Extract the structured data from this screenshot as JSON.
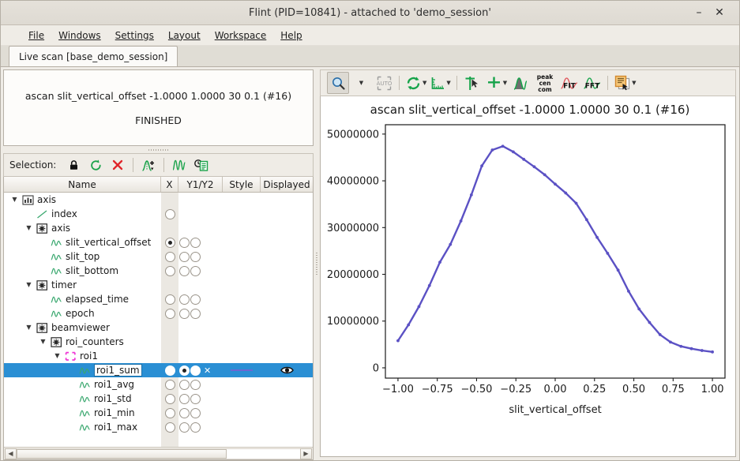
{
  "window": {
    "title": "Flint (PID=10841) - attached to 'demo_session'",
    "minimize_label": "–",
    "close_label": "✕"
  },
  "menubar": {
    "items": [
      {
        "label": "File"
      },
      {
        "label": "Windows"
      },
      {
        "label": "Settings"
      },
      {
        "label": "Layout"
      },
      {
        "label": "Workspace"
      },
      {
        "label": "Help"
      }
    ]
  },
  "tabs": [
    {
      "label": "Live scan [base_demo_session]",
      "active": true
    }
  ],
  "scan_info": {
    "command": "ascan slit_vertical_offset -1.0000 1.0000 30 0.1 (#16)",
    "state": "FINISHED"
  },
  "selection_toolbar": {
    "label": "Selection:",
    "buttons": [
      {
        "name": "lock-icon",
        "title": "lock"
      },
      {
        "name": "reset-icon",
        "title": "reset"
      },
      {
        "name": "remove-icon",
        "title": "remove"
      },
      {
        "name": "add-curve-icon",
        "title": "add curve"
      },
      {
        "name": "peaks-icon",
        "title": "peaks"
      },
      {
        "name": "scan-history-icon",
        "title": "scan history"
      }
    ]
  },
  "tree": {
    "columns": [
      "Name",
      "X",
      "Y1/Y2",
      "Style",
      "Displayed"
    ],
    "rows": [
      {
        "label": "axis",
        "depth": 0,
        "icon": "chart-icon",
        "expander": "down",
        "x": null,
        "y": null,
        "selected": false
      },
      {
        "label": "index",
        "depth": 1,
        "icon": "line-icon",
        "expander": "none",
        "x": "off",
        "y": null,
        "selected": false
      },
      {
        "label": "axis",
        "depth": 1,
        "icon": "device-icon",
        "expander": "down",
        "x": null,
        "y": null,
        "selected": false
      },
      {
        "label": "slit_vertical_offset",
        "depth": 2,
        "icon": "curve-icon",
        "expander": "none",
        "x": "on",
        "y": [
          "off",
          "off"
        ],
        "selected": false
      },
      {
        "label": "slit_top",
        "depth": 2,
        "icon": "curve-icon",
        "expander": "none",
        "x": "off",
        "y": [
          "off",
          "off"
        ],
        "selected": false
      },
      {
        "label": "slit_bottom",
        "depth": 2,
        "icon": "curve-icon",
        "expander": "none",
        "x": "off",
        "y": [
          "off",
          "off"
        ],
        "selected": false
      },
      {
        "label": "timer",
        "depth": 1,
        "icon": "device-icon",
        "expander": "down",
        "x": null,
        "y": null,
        "selected": false
      },
      {
        "label": "elapsed_time",
        "depth": 2,
        "icon": "curve-icon",
        "expander": "none",
        "x": "off",
        "y": [
          "off",
          "off"
        ],
        "selected": false
      },
      {
        "label": "epoch",
        "depth": 2,
        "icon": "curve-icon",
        "expander": "none",
        "x": "off",
        "y": [
          "off",
          "off"
        ],
        "selected": false
      },
      {
        "label": "beamviewer",
        "depth": 1,
        "icon": "device-icon",
        "expander": "down",
        "x": null,
        "y": null,
        "selected": false
      },
      {
        "label": "roi_counters",
        "depth": 2,
        "icon": "device-icon",
        "expander": "down",
        "x": null,
        "y": null,
        "selected": false
      },
      {
        "label": "roi1",
        "depth": 3,
        "icon": "roi-icon",
        "expander": "down",
        "x": null,
        "y": null,
        "selected": false
      },
      {
        "label": "roi1_sum",
        "depth": 4,
        "icon": "curve-icon",
        "expander": "none",
        "x": "off",
        "y": [
          "on",
          "off"
        ],
        "style_mark": "✕",
        "style_color": "#6d66d2",
        "displayed": "eye-icon",
        "selected": true
      },
      {
        "label": "roi1_avg",
        "depth": 4,
        "icon": "curve-icon",
        "expander": "none",
        "x": "off",
        "y": [
          "off",
          "off"
        ],
        "selected": false
      },
      {
        "label": "roi1_std",
        "depth": 4,
        "icon": "curve-icon",
        "expander": "none",
        "x": "off",
        "y": [
          "off",
          "off"
        ],
        "selected": false
      },
      {
        "label": "roi1_min",
        "depth": 4,
        "icon": "curve-icon",
        "expander": "none",
        "x": "off",
        "y": [
          "off",
          "off"
        ],
        "selected": false
      },
      {
        "label": "roi1_max",
        "depth": 4,
        "icon": "curve-icon",
        "expander": "none",
        "x": "off",
        "y": [
          "off",
          "off"
        ],
        "selected": false
      }
    ]
  },
  "plot_toolbar": {
    "buttons": [
      {
        "name": "zoom-icon",
        "title": "zoom",
        "active": true,
        "caret": true
      },
      {
        "name": "auto-scale-icon",
        "title": "auto scale"
      },
      {
        "name": "refresh-icon",
        "title": "refresh",
        "caret": true
      },
      {
        "name": "axis-scale-icon",
        "title": "axis scale",
        "caret": true
      },
      {
        "name": "cursor-marker-icon",
        "title": "cursor marker"
      },
      {
        "name": "crosshair-icon",
        "title": "crosshair",
        "caret": true
      },
      {
        "name": "gaussian-icon",
        "title": "gaussian"
      },
      {
        "name": "peak-cen-com-icon",
        "title": "peak cen com",
        "text": [
          "peak",
          "cen",
          "com"
        ]
      },
      {
        "name": "fit-icon",
        "title": "FIT",
        "text": [
          "FIT"
        ]
      },
      {
        "name": "fft-icon",
        "title": "FFT",
        "text": [
          "FFT"
        ]
      },
      {
        "name": "export-icon",
        "title": "export",
        "caret": true
      }
    ]
  },
  "chart_data": {
    "type": "line",
    "title": "ascan slit_vertical_offset -1.0000 1.0000 30 0.1 (#16)",
    "xlabel": "slit_vertical_offset",
    "ylabel": "",
    "xlim": [
      -1.08,
      1.08
    ],
    "ylim": [
      -2200000,
      52000000
    ],
    "xticks": [
      -1.0,
      -0.75,
      -0.5,
      -0.25,
      0.0,
      0.25,
      0.5,
      0.75,
      1.0
    ],
    "xticklabels": [
      "−1.00",
      "−0.75",
      "−0.50",
      "−0.25",
      "0.00",
      "0.25",
      "0.50",
      "0.75",
      "1.00"
    ],
    "yticks": [
      0,
      10000000,
      20000000,
      30000000,
      40000000,
      50000000
    ],
    "yticklabels": [
      "0",
      "10000000",
      "20000000",
      "30000000",
      "40000000",
      "50000000"
    ],
    "grid": false,
    "legend": false,
    "series": [
      {
        "name": "roi1_sum",
        "color": "#5b51c4",
        "marker": "dot",
        "x": [
          -1.0,
          -0.9333,
          -0.8667,
          -0.8,
          -0.7333,
          -0.6667,
          -0.6,
          -0.5333,
          -0.4667,
          -0.4,
          -0.3333,
          -0.2667,
          -0.2,
          -0.1333,
          -0.0667,
          0.0,
          0.0667,
          0.1333,
          0.2,
          0.2667,
          0.3333,
          0.4,
          0.4667,
          0.5333,
          0.6,
          0.6667,
          0.7333,
          0.8,
          0.8667,
          0.9333,
          1.0
        ],
        "y": [
          5800000,
          9200000,
          13100000,
          17600000,
          22600000,
          26400000,
          31400000,
          37000000,
          43200000,
          46600000,
          47400000,
          46200000,
          44600000,
          43000000,
          41300000,
          39300000,
          37400000,
          35200000,
          31700000,
          27900000,
          24500000,
          20900000,
          16400000,
          12600000,
          9700000,
          7100000,
          5500000,
          4600000,
          4100000,
          3700000,
          3400000
        ]
      }
    ]
  }
}
